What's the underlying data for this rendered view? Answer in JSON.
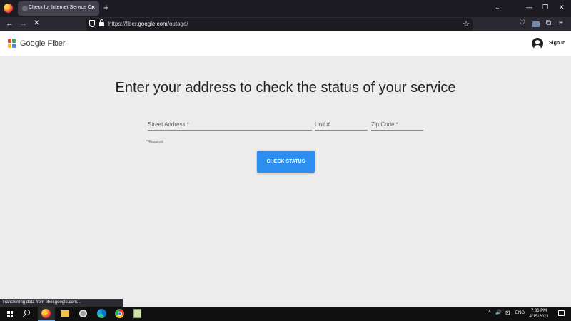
{
  "browser": {
    "tab_title": "Check for Internet Service Outa",
    "tab_close": "✕",
    "new_tab": "+",
    "tabs_list": "⌄",
    "window_controls": {
      "minimize": "—",
      "restore": "❐",
      "close": "✕"
    },
    "nav": {
      "back": "←",
      "forward": "→",
      "stop": "✕"
    },
    "url_prefix": "https://fiber.",
    "url_domain": "google.com",
    "url_path": "/outage/",
    "bookmark_icon": "☆",
    "toolbar": {
      "pocket": "♡",
      "extensions": "⧉",
      "menu": "≡"
    }
  },
  "site": {
    "brand": "Google Fiber",
    "logo_colors": [
      "#ea4335",
      "#34a853",
      "#fbbc04",
      "#4285f4"
    ],
    "sign_in": "Sign In"
  },
  "main": {
    "heading": "Enter your address to check the status of your service",
    "fields": {
      "street_placeholder": "Street Address *",
      "unit_placeholder": "Unit #",
      "zip_placeholder": "Zip Code *"
    },
    "required_note": "* Required",
    "check_button": "CHECK STATUS",
    "accent_color": "#2e8ef0"
  },
  "status_bar": "Transferring data from fiber.google.com...",
  "taskbar": {
    "search_icon": "search-icon",
    "apps": [
      "firefox",
      "file-explorer",
      "app-icon",
      "edge",
      "chrome",
      "notepad"
    ],
    "tray": {
      "chevron": "^",
      "volume": "🔊",
      "network": "⊡",
      "language": "ENG"
    },
    "time": "7:36 PM",
    "date": "4/15/2023"
  }
}
